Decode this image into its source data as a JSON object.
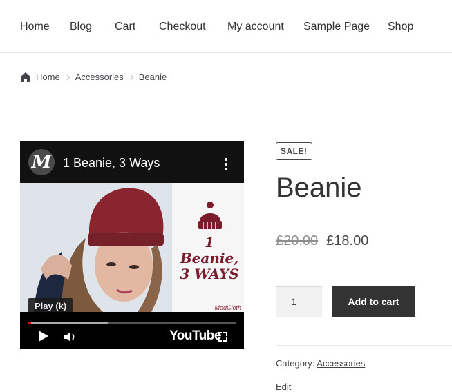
{
  "nav": {
    "items": [
      {
        "label": "Home"
      },
      {
        "label": "Blog"
      },
      {
        "label": "Cart"
      },
      {
        "label": "Checkout"
      },
      {
        "label": "My account"
      },
      {
        "label": "Sample Page"
      },
      {
        "label": "Shop"
      }
    ]
  },
  "breadcrumb": {
    "home": "Home",
    "category": "Accessories",
    "current": "Beanie"
  },
  "video": {
    "channel_initial": "M",
    "title": "1 Beanie, 3 Ways",
    "promo_line1": "1 Beanie,",
    "promo_line2": "3 WAYS",
    "brand": "ModCloth",
    "tooltip": "Play (k)",
    "youtube_label": "YouTube",
    "progress_loaded_fraction": 0.37
  },
  "product": {
    "badge": "SALE!",
    "title": "Beanie",
    "old_price": "£20.00",
    "price": "£18.00",
    "quantity": "1",
    "add_to_cart": "Add to cart",
    "category_label": "Category:",
    "category_link": "Accessories",
    "tags_partial": "Edit"
  }
}
